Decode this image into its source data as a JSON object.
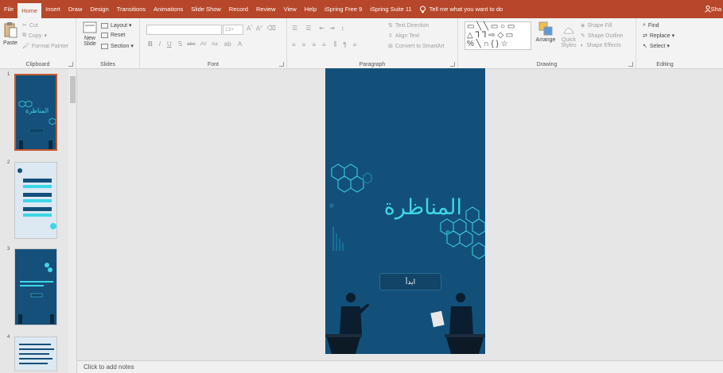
{
  "ribbon_tabs": [
    {
      "label": "File"
    },
    {
      "label": "Home"
    },
    {
      "label": "Insert"
    },
    {
      "label": "Draw"
    },
    {
      "label": "Design"
    },
    {
      "label": "Transitions"
    },
    {
      "label": "Animations"
    },
    {
      "label": "Slide Show"
    },
    {
      "label": "Record"
    },
    {
      "label": "Review"
    },
    {
      "label": "View"
    },
    {
      "label": "Help"
    },
    {
      "label": "iSpring Free 9"
    },
    {
      "label": "iSpring Suite 11"
    }
  ],
  "tell_me": "Tell me what you want to do",
  "share_label": "Sha",
  "clipboard": {
    "paste": "Paste",
    "cut": "Cut",
    "copy": "Copy",
    "format_painter": "Format Painter",
    "group_label": "Clipboard"
  },
  "slides_group": {
    "new_slide": "New",
    "new_slide_2": "Slide",
    "layout": "Layout",
    "reset": "Reset",
    "section": "Section",
    "group_label": "Slides"
  },
  "font_group": {
    "size": "13+",
    "bold": "B",
    "italic": "I",
    "underline": "U",
    "shadow": "S",
    "strike": "abc",
    "spacing": "AV",
    "case": "Aa",
    "group_label": "Font"
  },
  "paragraph_group": {
    "text_direction": "Text Direction",
    "align_text": "Align Text",
    "smartart": "Convert to SmartArt",
    "group_label": "Paragraph"
  },
  "drawing_group": {
    "arrange": "Arrange",
    "quick_styles": "Quick",
    "quick_styles_2": "Styles",
    "shape_fill": "Shape Fill",
    "shape_outline": "Shape Outline",
    "shape_effects": "Shape Effects",
    "group_label": "Drawing"
  },
  "editing_group": {
    "find": "Find",
    "replace": "Replace",
    "select": "Select",
    "group_label": "Editing"
  },
  "slides": [
    {
      "number": "1",
      "thumb_title": "المناظرة"
    },
    {
      "number": "2"
    },
    {
      "number": "3"
    },
    {
      "number": "4"
    }
  ],
  "slide": {
    "title": "المناظرة",
    "button_label": "ابدأ"
  },
  "notes_placeholder": "Click to add notes",
  "colors": {
    "ribbon_red": "#b7472a",
    "slide_bg": "#12507a",
    "accent_cyan": "#3ed6e8",
    "selected_border": "#c55a2f"
  }
}
